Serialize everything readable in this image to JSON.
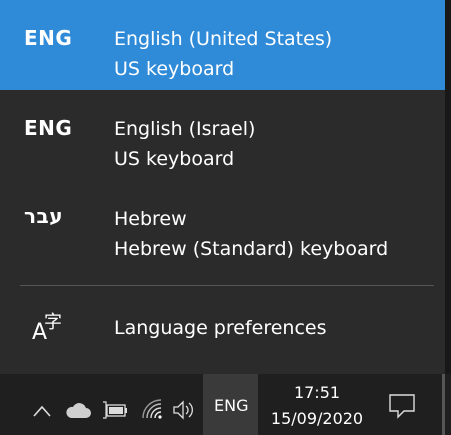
{
  "languages": [
    {
      "code": "ENG",
      "name": "English (United States)",
      "keyboard": "US keyboard",
      "selected": true
    },
    {
      "code": "ENG",
      "name": "English (Israel)",
      "keyboard": "US keyboard",
      "selected": false
    },
    {
      "code": "עבר",
      "name": "Hebrew",
      "keyboard": "Hebrew (Standard) keyboard",
      "selected": false
    }
  ],
  "preferences": {
    "label": "Language preferences",
    "icon": "language-preferences-icon",
    "glyph_a": "A",
    "glyph_zi": "字"
  },
  "taskbar": {
    "input_indicator": "ENG",
    "time": "17:51",
    "date": "15/09/2020"
  },
  "colors": {
    "accent": "#2f8ad8",
    "flyout_bg": "#2b2b2b",
    "taskbar_bg": "#1f1f1f"
  }
}
